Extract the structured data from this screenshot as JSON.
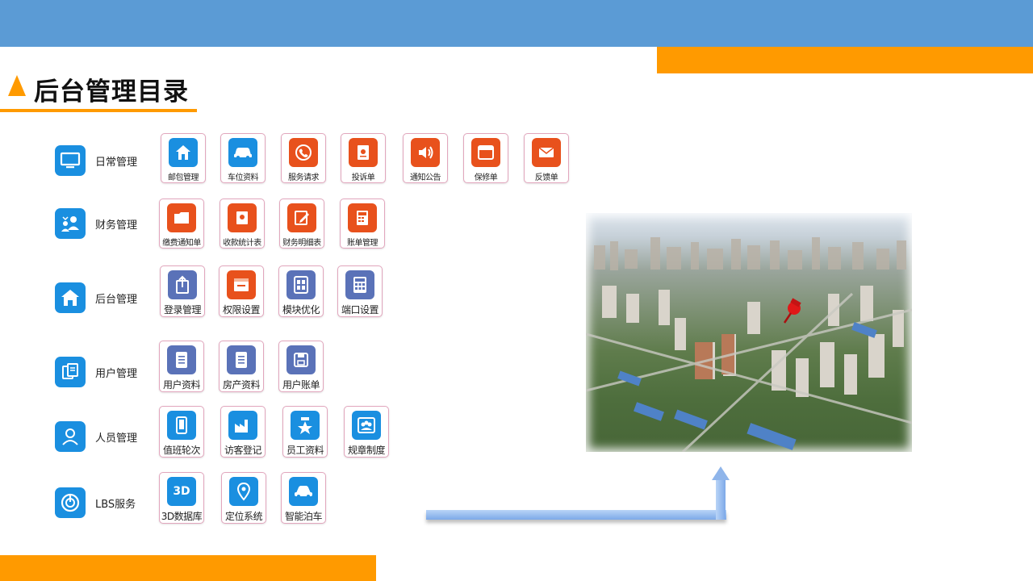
{
  "title": "后台管理目录",
  "categories": [
    {
      "label": "日常管理",
      "icon": "monitor-icon"
    },
    {
      "label": "财务管理",
      "icon": "finance-people-icon"
    },
    {
      "label": "后台管理",
      "icon": "house-icon"
    },
    {
      "label": "用户管理",
      "icon": "user-files-icon"
    },
    {
      "label": "人员管理",
      "icon": "person-icon"
    },
    {
      "label": "LBS服务",
      "icon": "power-icon"
    }
  ],
  "modules": {
    "daily": [
      "邮包管理",
      "车位资料",
      "服务请求",
      "投诉单",
      "通知公告",
      "保修单",
      "反馈单"
    ],
    "finance": [
      "缴费通知单",
      "收款统计表",
      "财务明细表",
      "账单管理"
    ],
    "backend": [
      "登录管理",
      "权限设置",
      "模块优化",
      "端口设置"
    ],
    "user": [
      "用户资料",
      "房产资料",
      "用户账单"
    ],
    "staff": [
      "值班轮次",
      "访客登记",
      "员工资料",
      "规章制度"
    ],
    "lbs": [
      "3D数据库",
      "定位系统",
      "智能泊车"
    ]
  },
  "lbs_3d_glyph": "3D",
  "colors": {
    "header_blue": "#5b9bd5",
    "accent_orange": "#ff9a00",
    "icon_blue": "#1a8fe0",
    "icon_red": "#e8511c",
    "icon_purple": "#5a72b8"
  }
}
